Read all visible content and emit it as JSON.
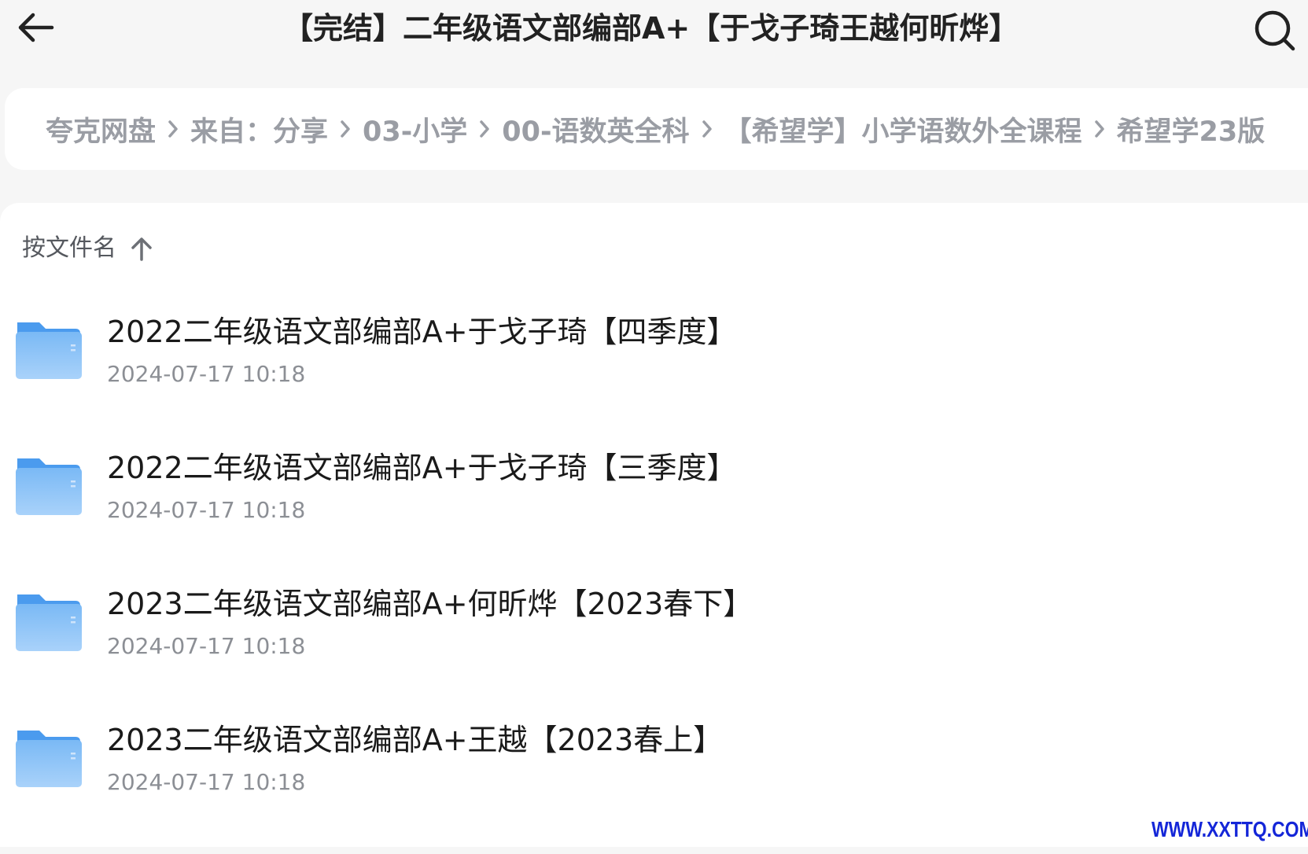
{
  "header": {
    "title": "【完结】二年级语文部编部A+【于戈子琦王越何昕烨】",
    "back_icon": "arrow-left-icon",
    "search_icon": "search-icon"
  },
  "breadcrumb": {
    "items": [
      "夸克网盘",
      "来自：分享",
      "03-小学",
      "00-语数英全科",
      "【希望学】小学语数外全课程",
      "希望学23版"
    ]
  },
  "sort": {
    "label": "按文件名",
    "direction_icon": "arrow-up-icon"
  },
  "files": [
    {
      "name": "2022二年级语文部编部A+于戈子琦【四季度】",
      "date": "2024-07-17 10:18",
      "icon": "folder-icon"
    },
    {
      "name": "2022二年级语文部编部A+于戈子琦【三季度】",
      "date": "2024-07-17 10:18",
      "icon": "folder-icon"
    },
    {
      "name": "2023二年级语文部编部A+何昕烨【2023春下】",
      "date": "2024-07-17 10:18",
      "icon": "folder-icon"
    },
    {
      "name": "2023二年级语文部编部A+王越【2023春上】",
      "date": "2024-07-17 10:18",
      "icon": "folder-icon"
    }
  ],
  "watermark": "WWW.XXTTQ.COM",
  "colors": {
    "background": "#f6f6f6",
    "surface": "#ffffff",
    "breadcrumb_text": "#9a9da4",
    "folder_blue": "#5fa9f0",
    "watermark_blue": "#1426d8"
  }
}
